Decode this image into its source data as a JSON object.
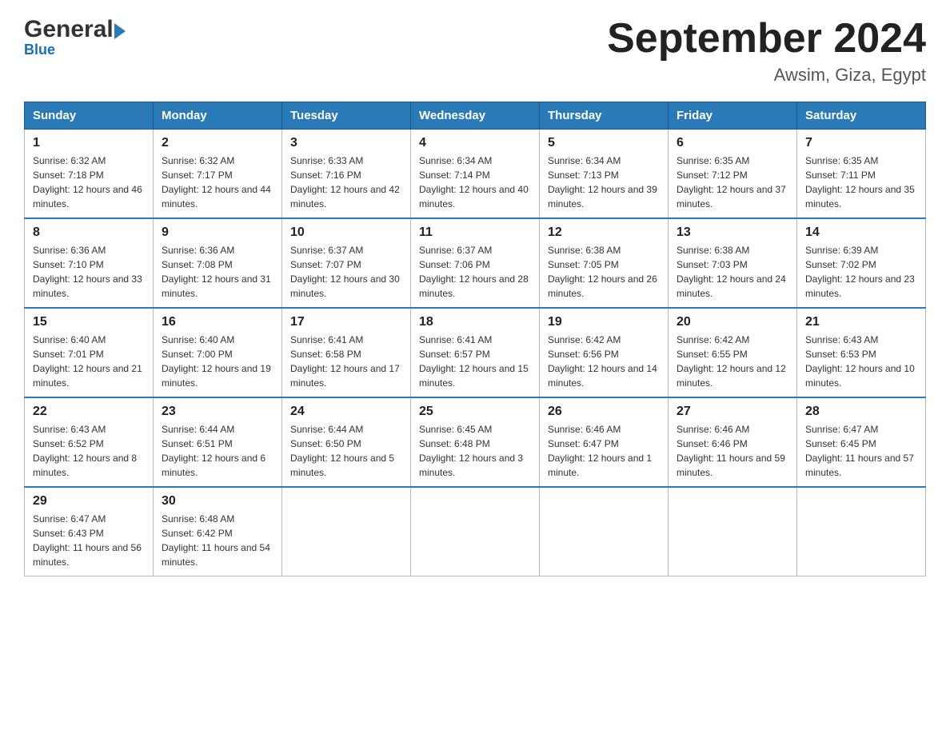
{
  "header": {
    "logo_general": "General",
    "logo_blue": "Blue",
    "month_title": "September 2024",
    "location": "Awsim, Giza, Egypt"
  },
  "days_of_week": [
    "Sunday",
    "Monday",
    "Tuesday",
    "Wednesday",
    "Thursday",
    "Friday",
    "Saturday"
  ],
  "weeks": [
    [
      {
        "day": "1",
        "sunrise": "6:32 AM",
        "sunset": "7:18 PM",
        "daylight": "12 hours and 46 minutes."
      },
      {
        "day": "2",
        "sunrise": "6:32 AM",
        "sunset": "7:17 PM",
        "daylight": "12 hours and 44 minutes."
      },
      {
        "day": "3",
        "sunrise": "6:33 AM",
        "sunset": "7:16 PM",
        "daylight": "12 hours and 42 minutes."
      },
      {
        "day": "4",
        "sunrise": "6:34 AM",
        "sunset": "7:14 PM",
        "daylight": "12 hours and 40 minutes."
      },
      {
        "day": "5",
        "sunrise": "6:34 AM",
        "sunset": "7:13 PM",
        "daylight": "12 hours and 39 minutes."
      },
      {
        "day": "6",
        "sunrise": "6:35 AM",
        "sunset": "7:12 PM",
        "daylight": "12 hours and 37 minutes."
      },
      {
        "day": "7",
        "sunrise": "6:35 AM",
        "sunset": "7:11 PM",
        "daylight": "12 hours and 35 minutes."
      }
    ],
    [
      {
        "day": "8",
        "sunrise": "6:36 AM",
        "sunset": "7:10 PM",
        "daylight": "12 hours and 33 minutes."
      },
      {
        "day": "9",
        "sunrise": "6:36 AM",
        "sunset": "7:08 PM",
        "daylight": "12 hours and 31 minutes."
      },
      {
        "day": "10",
        "sunrise": "6:37 AM",
        "sunset": "7:07 PM",
        "daylight": "12 hours and 30 minutes."
      },
      {
        "day": "11",
        "sunrise": "6:37 AM",
        "sunset": "7:06 PM",
        "daylight": "12 hours and 28 minutes."
      },
      {
        "day": "12",
        "sunrise": "6:38 AM",
        "sunset": "7:05 PM",
        "daylight": "12 hours and 26 minutes."
      },
      {
        "day": "13",
        "sunrise": "6:38 AM",
        "sunset": "7:03 PM",
        "daylight": "12 hours and 24 minutes."
      },
      {
        "day": "14",
        "sunrise": "6:39 AM",
        "sunset": "7:02 PM",
        "daylight": "12 hours and 23 minutes."
      }
    ],
    [
      {
        "day": "15",
        "sunrise": "6:40 AM",
        "sunset": "7:01 PM",
        "daylight": "12 hours and 21 minutes."
      },
      {
        "day": "16",
        "sunrise": "6:40 AM",
        "sunset": "7:00 PM",
        "daylight": "12 hours and 19 minutes."
      },
      {
        "day": "17",
        "sunrise": "6:41 AM",
        "sunset": "6:58 PM",
        "daylight": "12 hours and 17 minutes."
      },
      {
        "day": "18",
        "sunrise": "6:41 AM",
        "sunset": "6:57 PM",
        "daylight": "12 hours and 15 minutes."
      },
      {
        "day": "19",
        "sunrise": "6:42 AM",
        "sunset": "6:56 PM",
        "daylight": "12 hours and 14 minutes."
      },
      {
        "day": "20",
        "sunrise": "6:42 AM",
        "sunset": "6:55 PM",
        "daylight": "12 hours and 12 minutes."
      },
      {
        "day": "21",
        "sunrise": "6:43 AM",
        "sunset": "6:53 PM",
        "daylight": "12 hours and 10 minutes."
      }
    ],
    [
      {
        "day": "22",
        "sunrise": "6:43 AM",
        "sunset": "6:52 PM",
        "daylight": "12 hours and 8 minutes."
      },
      {
        "day": "23",
        "sunrise": "6:44 AM",
        "sunset": "6:51 PM",
        "daylight": "12 hours and 6 minutes."
      },
      {
        "day": "24",
        "sunrise": "6:44 AM",
        "sunset": "6:50 PM",
        "daylight": "12 hours and 5 minutes."
      },
      {
        "day": "25",
        "sunrise": "6:45 AM",
        "sunset": "6:48 PM",
        "daylight": "12 hours and 3 minutes."
      },
      {
        "day": "26",
        "sunrise": "6:46 AM",
        "sunset": "6:47 PM",
        "daylight": "12 hours and 1 minute."
      },
      {
        "day": "27",
        "sunrise": "6:46 AM",
        "sunset": "6:46 PM",
        "daylight": "11 hours and 59 minutes."
      },
      {
        "day": "28",
        "sunrise": "6:47 AM",
        "sunset": "6:45 PM",
        "daylight": "11 hours and 57 minutes."
      }
    ],
    [
      {
        "day": "29",
        "sunrise": "6:47 AM",
        "sunset": "6:43 PM",
        "daylight": "11 hours and 56 minutes."
      },
      {
        "day": "30",
        "sunrise": "6:48 AM",
        "sunset": "6:42 PM",
        "daylight": "11 hours and 54 minutes."
      },
      null,
      null,
      null,
      null,
      null
    ]
  ]
}
